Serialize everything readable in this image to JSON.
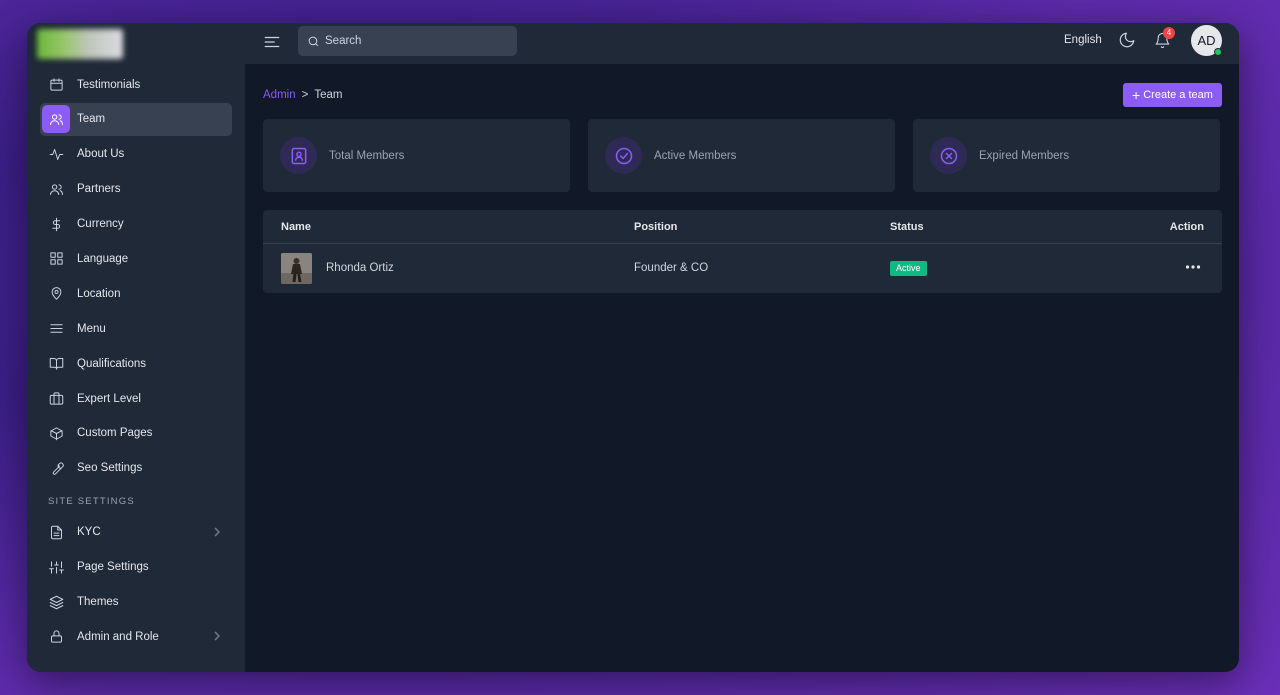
{
  "sidebar": {
    "items": [
      {
        "label": "Testimonials",
        "icon": "calendar-icon"
      },
      {
        "label": "Team",
        "icon": "users-icon",
        "active": true
      },
      {
        "label": "About Us",
        "icon": "activity-icon"
      },
      {
        "label": "Partners",
        "icon": "partners-icon"
      },
      {
        "label": "Currency",
        "icon": "dollar-icon"
      },
      {
        "label": "Language",
        "icon": "grid-icon"
      },
      {
        "label": "Location",
        "icon": "map-pin-icon"
      },
      {
        "label": "Menu",
        "icon": "menu-icon"
      },
      {
        "label": "Qualifications",
        "icon": "book-icon"
      },
      {
        "label": "Expert Level",
        "icon": "briefcase-icon"
      },
      {
        "label": "Custom Pages",
        "icon": "box-icon"
      },
      {
        "label": "Seo Settings",
        "icon": "wrench-icon"
      }
    ],
    "section_label": "SITE SETTINGS",
    "settings_items": [
      {
        "label": "KYC",
        "icon": "file-icon",
        "has_chevron": true
      },
      {
        "label": "Page Settings",
        "icon": "sliders-icon"
      },
      {
        "label": "Themes",
        "icon": "layers-icon"
      },
      {
        "label": "Admin and Role",
        "icon": "lock-icon",
        "has_chevron": true
      }
    ]
  },
  "topbar": {
    "search_placeholder": "Search",
    "language": "English",
    "notification_count": "4",
    "avatar_initials": "AD",
    "status_color": "#22c55e"
  },
  "breadcrumb": {
    "root": "Admin",
    "separator": ">",
    "current": "Team"
  },
  "create_button": {
    "plus": "+",
    "label": "Create a team"
  },
  "stats": [
    {
      "label": "Total Members",
      "icon": "id-badge-icon"
    },
    {
      "label": "Active Members",
      "icon": "check-circle-icon"
    },
    {
      "label": "Expired Members",
      "icon": "x-circle-icon"
    }
  ],
  "table": {
    "columns": [
      "Name",
      "Position",
      "Status",
      "Action"
    ],
    "rows": [
      {
        "name": "Rhonda Ortiz",
        "position": "Founder & CO",
        "status": "Active",
        "status_color": "#10b981"
      }
    ]
  },
  "colors": {
    "accent": "#8b5cf6",
    "sidebar_bg": "#1f2937",
    "main_bg": "#111827",
    "badge_red": "#ef4444"
  }
}
